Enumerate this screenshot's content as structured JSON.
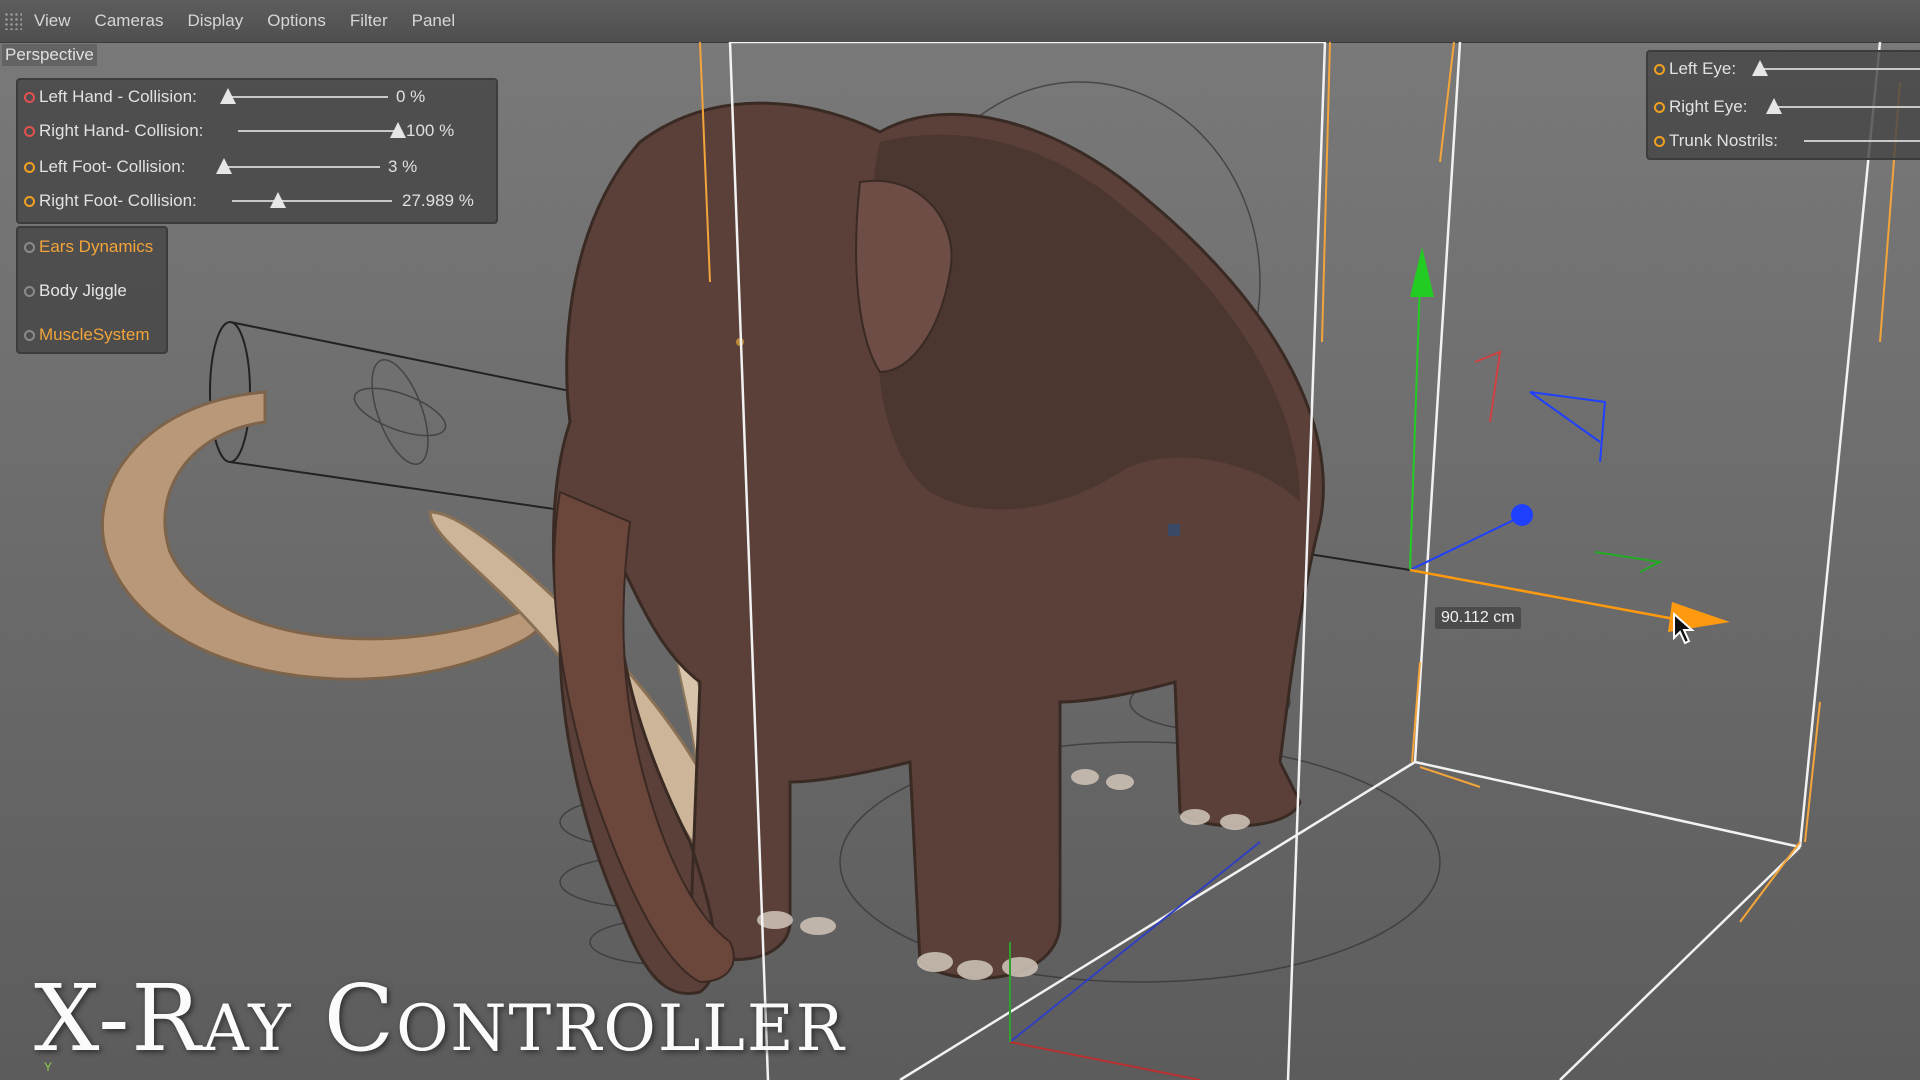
{
  "menubar": {
    "items": [
      "View",
      "Cameras",
      "Display",
      "Options",
      "Filter",
      "Panel"
    ]
  },
  "viewport": {
    "label": "Perspective"
  },
  "collision_panel": {
    "rows": [
      {
        "label": "Left Hand - Collision:",
        "value": "0 %",
        "fraction": 0.0,
        "radio": "red"
      },
      {
        "label": "Right Hand- Collision:",
        "value": "100 %",
        "fraction": 1.0,
        "radio": "red"
      },
      {
        "label": "Left Foot- Collision:",
        "value": "3 %",
        "fraction": 0.03,
        "radio": "orange"
      },
      {
        "label": "Right Foot- Collision:",
        "value": "27.989 %",
        "fraction": 0.28,
        "radio": "orange"
      }
    ]
  },
  "dynamics_panel": {
    "items": [
      {
        "label": "Ears Dynamics",
        "style": "orange"
      },
      {
        "label": "Body Jiggle",
        "style": "white"
      },
      {
        "label": "MuscleSystem",
        "style": "orange"
      }
    ]
  },
  "face_panel": {
    "rows": [
      {
        "label": "Left Eye:"
      },
      {
        "label": "Right Eye:"
      },
      {
        "label": "Trunk Nostrils:"
      }
    ]
  },
  "measurement": "90.112 cm",
  "title": "X-Ray Controller",
  "axis_label": "Y",
  "colors": {
    "accent_orange": "#f3a43a",
    "radio_red": "#e25050",
    "gizmo_green": "#22cc22",
    "gizmo_blue": "#2040ff",
    "gizmo_orange": "#ff9a10"
  },
  "icons": [
    "grip-icon",
    "cursor-arrow-icon"
  ]
}
